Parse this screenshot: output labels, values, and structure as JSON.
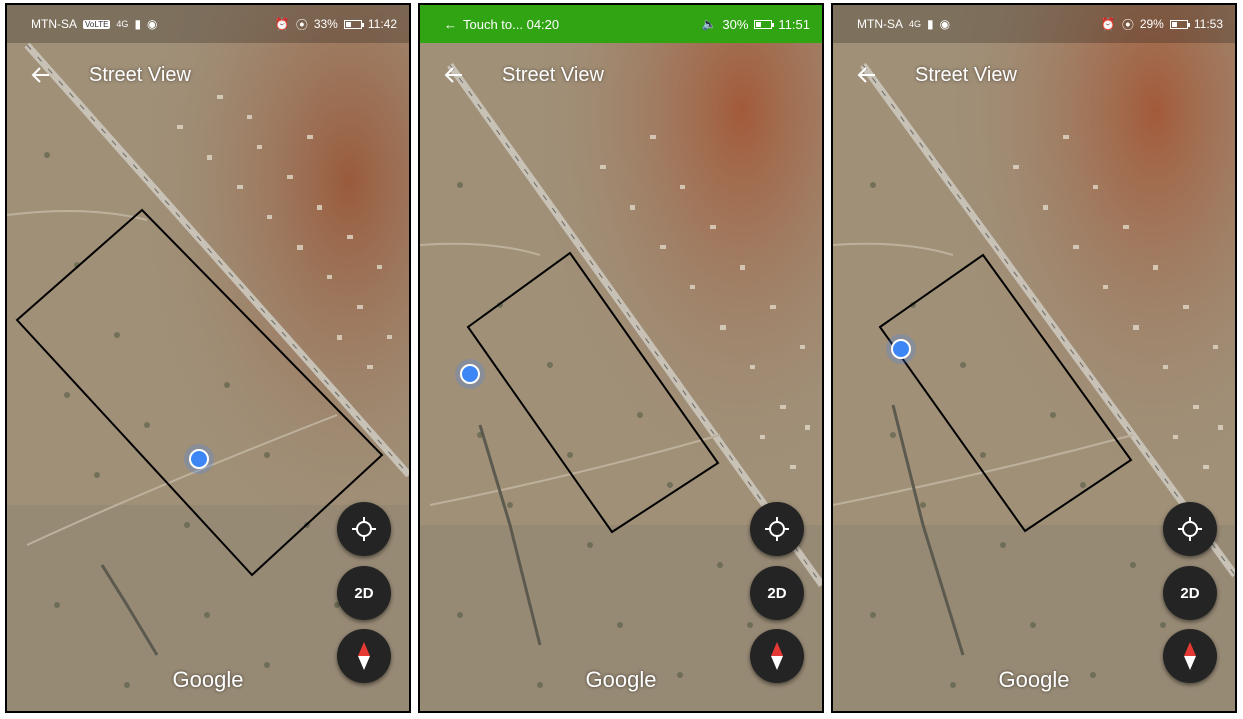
{
  "panels": [
    {
      "status": {
        "carrier": "MTN-SA",
        "network_badge": "VoLTE",
        "signal": "4G",
        "battery": "33%",
        "time": "11:42"
      },
      "title": "Street View",
      "fab_2d_label": "2D",
      "watermark": "Google"
    },
    {
      "status": {
        "touch_text": "Touch to... 04:20",
        "battery": "30%",
        "time": "11:51"
      },
      "title": "Street View",
      "fab_2d_label": "2D",
      "watermark": "Google"
    },
    {
      "status": {
        "carrier": "MTN-SA",
        "signal": "4G",
        "battery": "29%",
        "time": "11:53"
      },
      "title": "Street View",
      "fab_2d_label": "2D",
      "watermark": "Google"
    }
  ],
  "colors": {
    "location_dot": "#3d86f5",
    "fab_background": "#242424",
    "call_bar": "#31a414",
    "boundary": "#000000",
    "road": "#c8c2b6"
  },
  "icons": [
    "back-arrow-icon",
    "my-location-icon",
    "compass-icon",
    "alarm-icon",
    "location-pin-icon",
    "battery-icon",
    "signal-icon",
    "eye-icon",
    "speaker-icon"
  ]
}
